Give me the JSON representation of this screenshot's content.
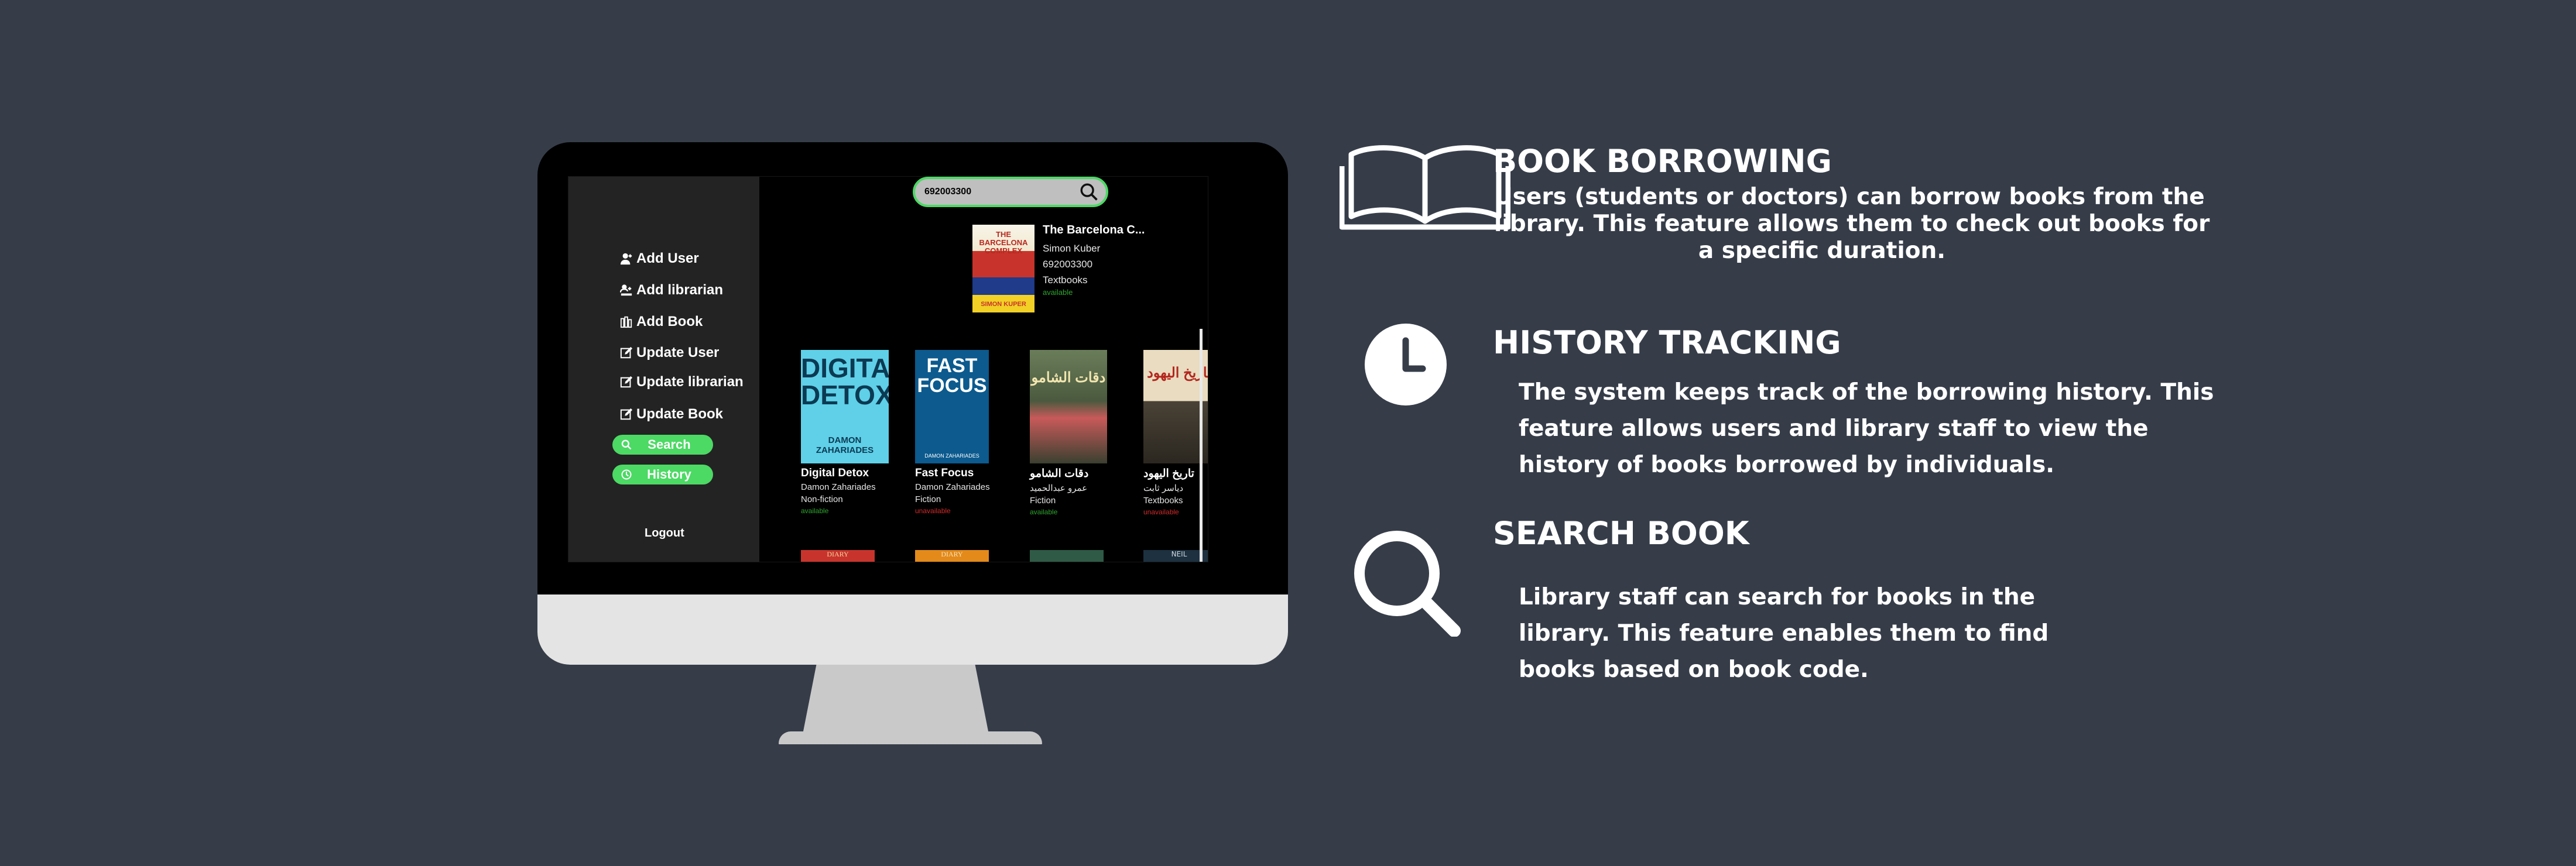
{
  "sidebar": {
    "items": [
      {
        "label": "Add User",
        "icon": "user-add-icon"
      },
      {
        "label": "Add librarian",
        "icon": "librarian-add-icon"
      },
      {
        "label": "Add Book",
        "icon": "books-add-icon"
      },
      {
        "label": "Update User",
        "icon": "edit-icon"
      },
      {
        "label": "Update librarian",
        "icon": "edit-icon"
      },
      {
        "label": "Update Book",
        "icon": "edit-icon"
      }
    ],
    "search_label": "Search",
    "history_label": "History",
    "logout_label": "Logout",
    "accent": "#4cd964"
  },
  "search": {
    "value": "692003300",
    "icon": "search-icon"
  },
  "result": {
    "title": "The Barcelona C...",
    "author": "Simon Kuber",
    "code": "692003300",
    "category": "Textbooks",
    "status": "available",
    "cover_text": "THE BARCELONA COMPLEX",
    "cover_author": "SIMON KUPER"
  },
  "books": [
    {
      "title": "Digital Detox",
      "author": "Damon Zahariades",
      "category": "Non-fiction",
      "status": "available",
      "cover_title": "DIGITAL DETOX",
      "cover_author": "DAMON ZAHARIADES"
    },
    {
      "title": "Fast Focus",
      "author": "Damon Zahariades",
      "category": "Fiction",
      "status": "unavailable",
      "cover_title": "FAST FOCUS",
      "cover_author": "DAMON ZAHARIADES"
    },
    {
      "title": "دقات الشامو",
      "author": "عمرو عبدالحميد",
      "category": "Fiction",
      "status": "available",
      "cover_title": "دقات الشامو"
    },
    {
      "title": "تاريخ اليهود",
      "author": "دياسر ثابت",
      "category": "Textbooks",
      "status": "unavailable",
      "cover_title": "تاريخ اليهود"
    }
  ],
  "row2_covers": [
    {
      "label": "DIARY",
      "color": "#c8342c"
    },
    {
      "label": "DIARY",
      "color": "#e38a1b"
    },
    {
      "label": "",
      "color": "#2f5a46"
    },
    {
      "label": "NEIL",
      "color": "#1d3140"
    }
  ],
  "status_colors": {
    "available": "#2ea52e",
    "unavailable": "#d42a2a"
  },
  "features": [
    {
      "icon": "open-book-icon",
      "title": "BOOK BORROWING",
      "lines": [
        "Users (students or doctors) can borrow books from the",
        "library. This feature allows them to check out books for",
        "a specific duration."
      ]
    },
    {
      "icon": "clock-icon",
      "title": "HISTORY TRACKING",
      "lines": [
        "The system keeps track of the borrowing history. This",
        "feature allows users and library staff to view the",
        "history of books borrowed by individuals."
      ]
    },
    {
      "icon": "magnifier-icon",
      "title": "SEARCH BOOK",
      "lines": [
        "Library staff can search for books in the",
        "library. This feature enables them to find",
        "books based on book code."
      ]
    }
  ]
}
